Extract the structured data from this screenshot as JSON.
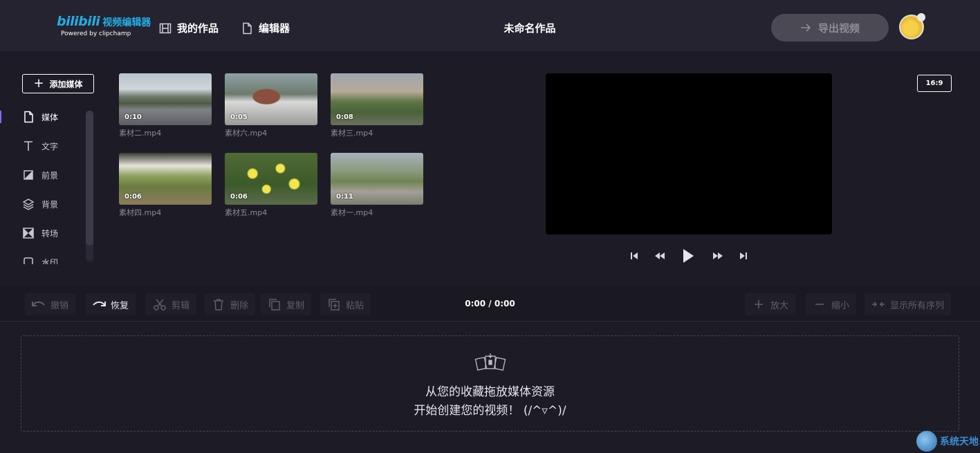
{
  "header": {
    "logo_brand": "bilibili",
    "logo_product": "视频编辑器",
    "logo_sub": "Powered by clipchamp",
    "nav_my_works": "我的作品",
    "nav_editor": "编辑器",
    "project_title": "未命名作品",
    "export_label": "导出视频"
  },
  "sidebar": {
    "add_media_label": "添加媒体",
    "items": [
      {
        "label": "媒体",
        "icon": "file-icon"
      },
      {
        "label": "文字",
        "icon": "text-icon"
      },
      {
        "label": "前景",
        "icon": "foreground-icon"
      },
      {
        "label": "背景",
        "icon": "layers-icon"
      },
      {
        "label": "转场",
        "icon": "transition-icon"
      },
      {
        "label": "水印",
        "icon": "watermark-icon"
      }
    ]
  },
  "media": [
    {
      "name": "素材二.mp4",
      "duration": "0:10"
    },
    {
      "name": "素材六.mp4",
      "duration": "0:05"
    },
    {
      "name": "素材三.mp4",
      "duration": "0:08"
    },
    {
      "name": "素材四.mp4",
      "duration": "0:06"
    },
    {
      "name": "素材五.mp4",
      "duration": "0:06"
    },
    {
      "name": "素材一.mp4",
      "duration": "0:11"
    }
  ],
  "preview": {
    "aspect_ratio": "16:9"
  },
  "toolbar": {
    "undo": "撤销",
    "redo": "恢复",
    "cut": "剪辑",
    "delete": "删除",
    "copy": "复制",
    "paste": "粘贴",
    "timecode": "0:00 / 0:00",
    "zoom_in": "放大",
    "zoom_out": "缩小",
    "show_all": "显示所有序列"
  },
  "dropzone": {
    "line1": "从您的收藏拖放媒体资源",
    "line2": "开始创建您的视频！ (/^▿^)/"
  },
  "watermark": "系统天地",
  "colors": {
    "background": "#1d1c26",
    "header": "#24232f",
    "brand": "#23ade5",
    "accent": "#7d6cf5"
  }
}
